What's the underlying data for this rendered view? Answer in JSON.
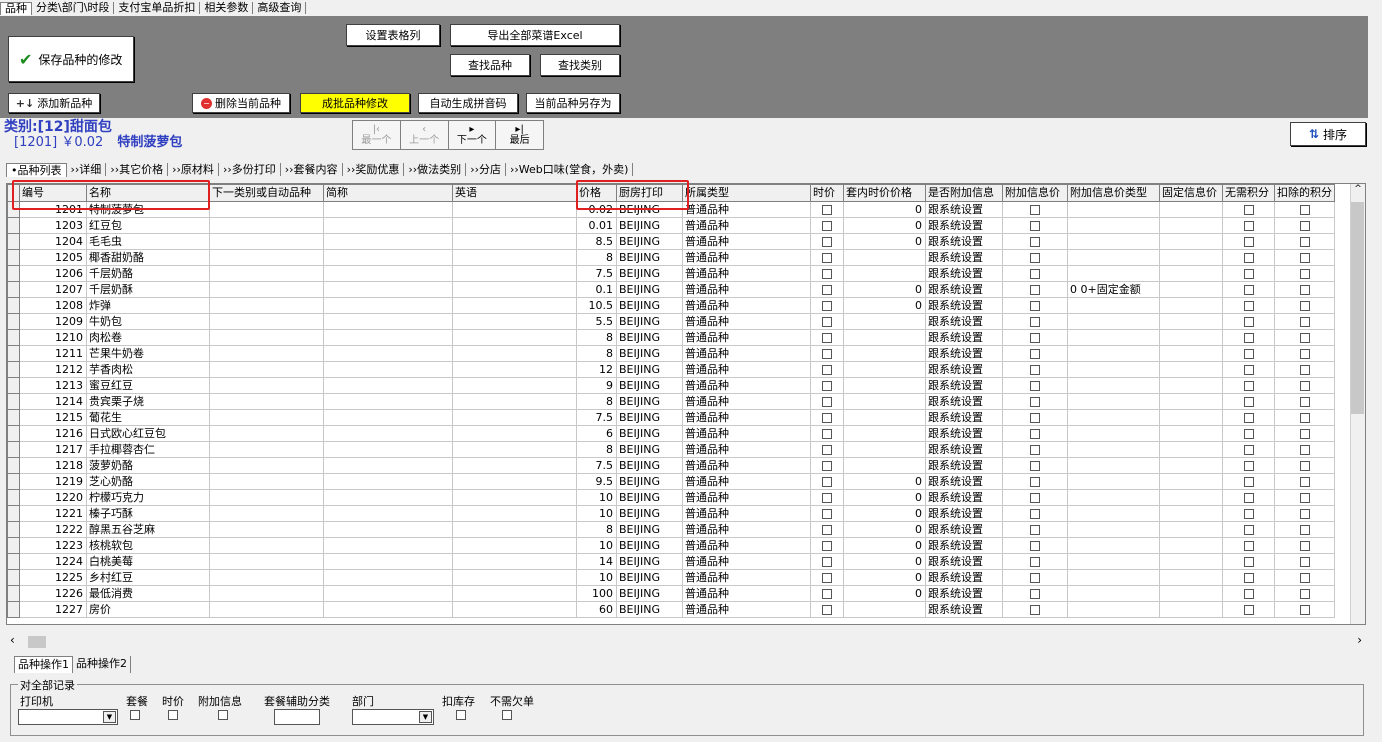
{
  "top_tabs": [
    "品种",
    "分类\\部门\\时段",
    "支付宝单品折扣",
    "相关参数",
    "高级查询"
  ],
  "buttons": {
    "save": "保存品种的修改",
    "set_spec": "设置表格列",
    "export_excel": "导出全部菜谱Excel",
    "find_item": "查找品种",
    "find_category": "查找类别",
    "add_item": "添加新品种",
    "delete_item": "删除当前品种",
    "batch_modify": "成批品种修改",
    "auto_code": "自动生成拼音码",
    "save_as": "当前品种另存为",
    "sort": "排序"
  },
  "category": {
    "line1": "类别:[12]甜面包",
    "line2_code": "[1201] ￥0.02",
    "line2_name": "特制菠萝包"
  },
  "nav": {
    "first": "最一个",
    "prev": "上一个",
    "next": "下一个",
    "last": "最后"
  },
  "sub_tabs": [
    "•品种列表",
    "››详细",
    "››其它价格",
    "››原材料",
    "››多份打印",
    "››套餐内容",
    "››奖励优惠",
    "››做法类别",
    "››分店",
    "››Web口味(堂食，外卖)"
  ],
  "columns": [
    "编号",
    "名称",
    "下一类别或自动品种",
    "简称",
    "英语",
    "价格",
    "厨房打印",
    "所属类型",
    "时价",
    "套内时价价格",
    "是否附加信息",
    "附加信息价",
    "附加信息价类型",
    "固定信息价",
    "无需积分",
    "扣除的积分"
  ],
  "rows": [
    {
      "code": "1201",
      "name": "特制菠萝包",
      "price": "0.02",
      "printer": "BEIJING",
      "type": "普通品种",
      "time_price": "0",
      "sys": "跟系统设置",
      "extra_type": ""
    },
    {
      "code": "1203",
      "name": "红豆包",
      "price": "0.01",
      "printer": "BEIJING",
      "type": "普通品种",
      "time_price": "0",
      "sys": "跟系统设置",
      "extra_type": ""
    },
    {
      "code": "1204",
      "name": "毛毛虫",
      "price": "8.5",
      "printer": "BEIJING",
      "type": "普通品种",
      "time_price": "0",
      "sys": "跟系统设置",
      "extra_type": ""
    },
    {
      "code": "1205",
      "name": "椰香甜奶酪",
      "price": "8",
      "printer": "BEIJING",
      "type": "普通品种",
      "time_price": "",
      "sys": "跟系统设置",
      "extra_type": ""
    },
    {
      "code": "1206",
      "name": "千层奶酪",
      "price": "7.5",
      "printer": "BEIJING",
      "type": "普通品种",
      "time_price": "",
      "sys": "跟系统设置",
      "extra_type": ""
    },
    {
      "code": "1207",
      "name": "千层奶酥",
      "price": "0.1",
      "printer": "BEIJING",
      "type": "普通品种",
      "time_price": "0",
      "sys": "跟系统设置",
      "extra_type": "0 0+固定金额"
    },
    {
      "code": "1208",
      "name": "炸弹",
      "price": "10.5",
      "printer": "BEIJING",
      "type": "普通品种",
      "time_price": "0",
      "sys": "跟系统设置",
      "extra_type": ""
    },
    {
      "code": "1209",
      "name": "牛奶包",
      "price": "5.5",
      "printer": "BEIJING",
      "type": "普通品种",
      "time_price": "",
      "sys": "跟系统设置",
      "extra_type": ""
    },
    {
      "code": "1210",
      "name": "肉松卷",
      "price": "8",
      "printer": "BEIJING",
      "type": "普通品种",
      "time_price": "",
      "sys": "跟系统设置",
      "extra_type": ""
    },
    {
      "code": "1211",
      "name": "芒果牛奶卷",
      "price": "8",
      "printer": "BEIJING",
      "type": "普通品种",
      "time_price": "",
      "sys": "跟系统设置",
      "extra_type": ""
    },
    {
      "code": "1212",
      "name": "芋香肉松",
      "price": "12",
      "printer": "BEIJING",
      "type": "普通品种",
      "time_price": "",
      "sys": "跟系统设置",
      "extra_type": ""
    },
    {
      "code": "1213",
      "name": "蜜豆红豆",
      "price": "9",
      "printer": "BEIJING",
      "type": "普通品种",
      "time_price": "",
      "sys": "跟系统设置",
      "extra_type": ""
    },
    {
      "code": "1214",
      "name": "贵宾栗子烧",
      "price": "8",
      "printer": "BEIJING",
      "type": "普通品种",
      "time_price": "",
      "sys": "跟系统设置",
      "extra_type": ""
    },
    {
      "code": "1215",
      "name": "葡花生",
      "price": "7.5",
      "printer": "BEIJING",
      "type": "普通品种",
      "time_price": "",
      "sys": "跟系统设置",
      "extra_type": ""
    },
    {
      "code": "1216",
      "name": "日式欧心红豆包",
      "price": "6",
      "printer": "BEIJING",
      "type": "普通品种",
      "time_price": "",
      "sys": "跟系统设置",
      "extra_type": ""
    },
    {
      "code": "1217",
      "name": "手拉椰蓉杏仁",
      "price": "8",
      "printer": "BEIJING",
      "type": "普通品种",
      "time_price": "",
      "sys": "跟系统设置",
      "extra_type": ""
    },
    {
      "code": "1218",
      "name": "菠萝奶酪",
      "price": "7.5",
      "printer": "BEIJING",
      "type": "普通品种",
      "time_price": "",
      "sys": "跟系统设置",
      "extra_type": ""
    },
    {
      "code": "1219",
      "name": "芝心奶酪",
      "price": "9.5",
      "printer": "BEIJING",
      "type": "普通品种",
      "time_price": "0",
      "sys": "跟系统设置",
      "extra_type": ""
    },
    {
      "code": "1220",
      "name": "柠檬巧克力",
      "price": "10",
      "printer": "BEIJING",
      "type": "普通品种",
      "time_price": "0",
      "sys": "跟系统设置",
      "extra_type": ""
    },
    {
      "code": "1221",
      "name": "榛子巧酥",
      "price": "10",
      "printer": "BEIJING",
      "type": "普通品种",
      "time_price": "0",
      "sys": "跟系统设置",
      "extra_type": ""
    },
    {
      "code": "1222",
      "name": "醇黑五谷芝麻",
      "price": "8",
      "printer": "BEIJING",
      "type": "普通品种",
      "time_price": "0",
      "sys": "跟系统设置",
      "extra_type": ""
    },
    {
      "code": "1223",
      "name": "核桃软包",
      "price": "10",
      "printer": "BEIJING",
      "type": "普通品种",
      "time_price": "0",
      "sys": "跟系统设置",
      "extra_type": ""
    },
    {
      "code": "1224",
      "name": "白桃美莓",
      "price": "14",
      "printer": "BEIJING",
      "type": "普通品种",
      "time_price": "0",
      "sys": "跟系统设置",
      "extra_type": ""
    },
    {
      "code": "1225",
      "name": "乡村红豆",
      "price": "10",
      "printer": "BEIJING",
      "type": "普通品种",
      "time_price": "0",
      "sys": "跟系统设置",
      "extra_type": ""
    },
    {
      "code": "1226",
      "name": "最低消费",
      "price": "100",
      "printer": "BEIJING",
      "type": "普通品种",
      "time_price": "0",
      "sys": "跟系统设置",
      "extra_type": ""
    },
    {
      "code": "1227",
      "name": "房价",
      "price": "60",
      "printer": "BEIJING",
      "type": "普通品种",
      "time_price": "",
      "sys": "跟系统设置",
      "extra_type": ""
    }
  ],
  "op_tabs": [
    "品种操作1",
    "品种操作2"
  ],
  "group": {
    "title": "对全部记录",
    "printer": "打印机",
    "package": "套餐",
    "time_price": "时价",
    "extra_info": "附加信息",
    "package_cat": "套餐辅助分类",
    "department": "部门",
    "stock": "扣库存",
    "no_discount": "不需欠单"
  },
  "colors": {
    "panel": "#7f7f7f",
    "highlight": "#ffff00",
    "category_text": "#3040c0",
    "annotation": "#e02020"
  }
}
